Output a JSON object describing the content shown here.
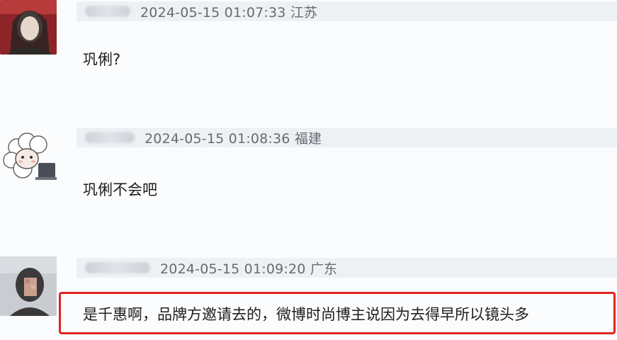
{
  "comments": [
    {
      "meta": "2024-05-15 01:07:33 江苏",
      "text": "巩俐?"
    },
    {
      "meta": "2024-05-15 01:08:36 福建",
      "text": "巩俐不会吧"
    },
    {
      "meta": "2024-05-15 01:09:20 广东",
      "text": "是千惠啊，品牌方邀请去的，微博时尚博主说因为去得早所以镜头多"
    }
  ],
  "colors": {
    "highlight_border": "#e0251f",
    "meta_bar": "#eef1f4",
    "meta_text": "#666b72",
    "body_text": "#1e1e1e"
  }
}
